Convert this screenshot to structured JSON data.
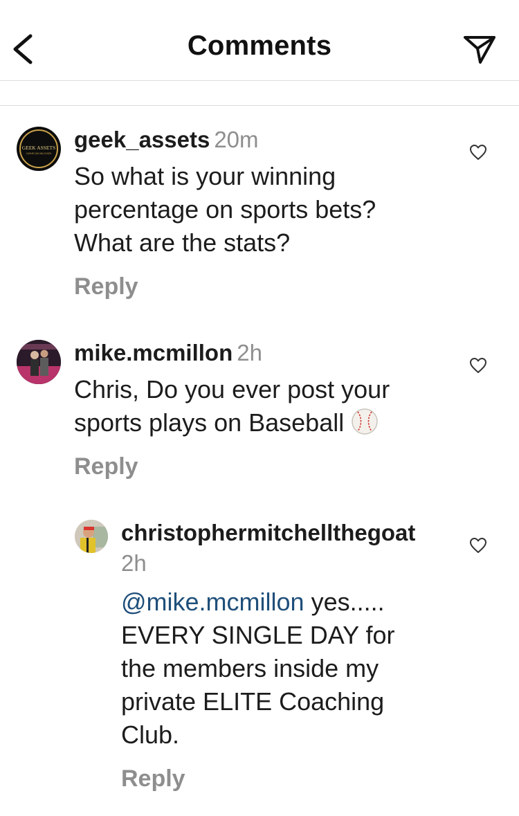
{
  "header": {
    "title": "Comments"
  },
  "comments": [
    {
      "avatar_text_top": "GEEK ASSETS",
      "avatar_text_bottom": "CASHFLOW UNLOCKED",
      "username": "geek_assets",
      "time": "20m",
      "lines": [
        "So what is your winning",
        "percentage on sports bets?",
        "What are the stats?"
      ],
      "reply_label": "Reply"
    },
    {
      "username": "mike.mcmillon",
      "time": "2h",
      "lines": [
        "Chris, Do you ever post your",
        "sports plays on Baseball"
      ],
      "emoji": "⚾",
      "reply_label": "Reply"
    },
    {
      "username": "christophermitchellthegoat",
      "time": "2h",
      "mention": "@mike.mcmillon",
      "first_line_rest": " yes.....",
      "lines": [
        "EVERY SINGLE DAY for",
        "the members inside my",
        "private ELITE Coaching",
        "Club."
      ],
      "reply_label": "Reply"
    }
  ],
  "colors": {
    "text": "#1c1c1c",
    "secondary": "#8e8e8e",
    "mention": "#1f4f7a",
    "divider": "#dcdcdc"
  },
  "icons": [
    "chevron-left-icon",
    "send-icon",
    "heart-icon"
  ]
}
